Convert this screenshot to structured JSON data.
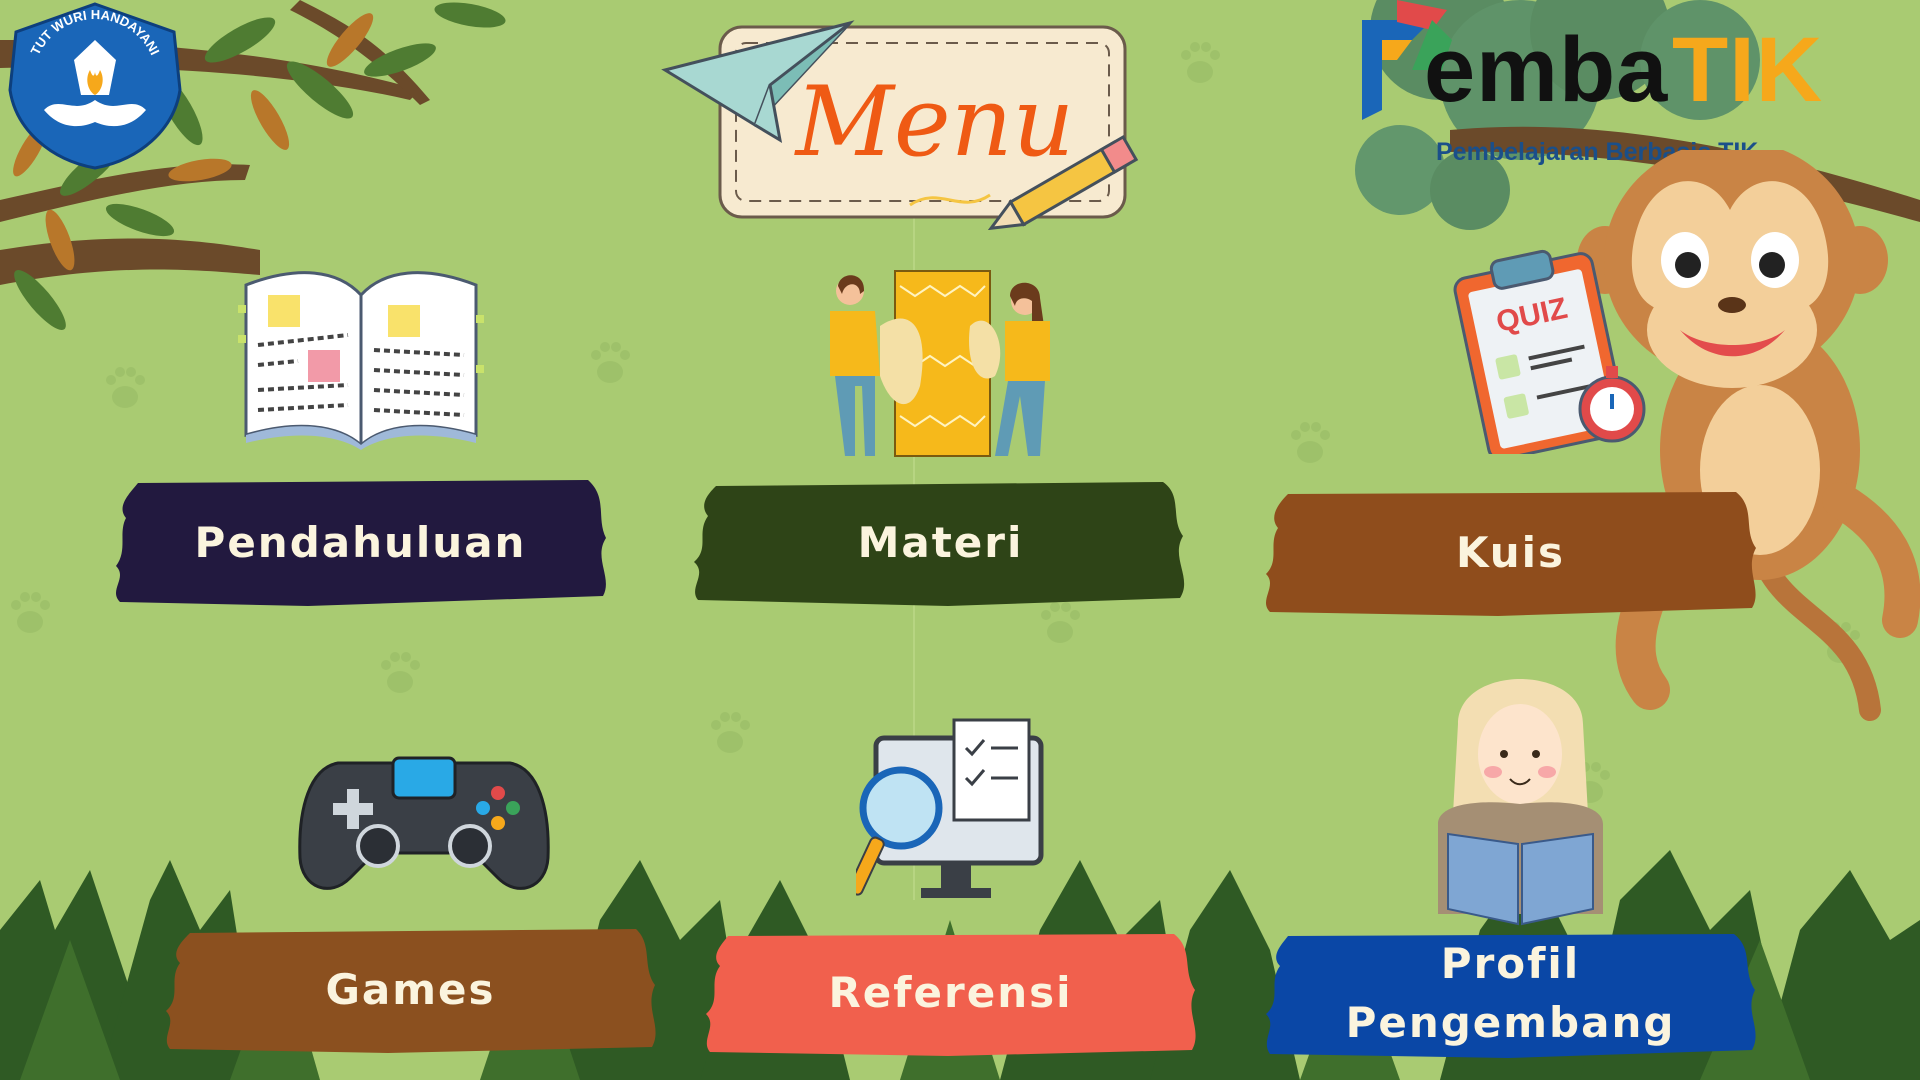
{
  "header": {
    "title": "Menu",
    "brand_name_prefix": "emba",
    "brand_name_suffix": "TIK",
    "brand_tagline": "Pembelajaran Berbasis TIK",
    "ministry_logo_text": "TUT WURI HANDAYANI"
  },
  "menu": {
    "pendahuluan": "Pendahuluan",
    "materi": "Materi",
    "kuis": "Kuis",
    "games": "Games",
    "referensi": "Referensi",
    "profil": "Profil Pengembang"
  },
  "quiz_board_text": "QUIZ",
  "colors": {
    "background": "#a9cb72",
    "pendahuluan": "#22193f",
    "materi": "#2e4417",
    "kuis": "#8f4d1c",
    "games": "#8b501f",
    "referensi": "#f1604d",
    "profil": "#0a47a6",
    "title_orange": "#ef5a14",
    "label_text": "#fbf4de"
  }
}
